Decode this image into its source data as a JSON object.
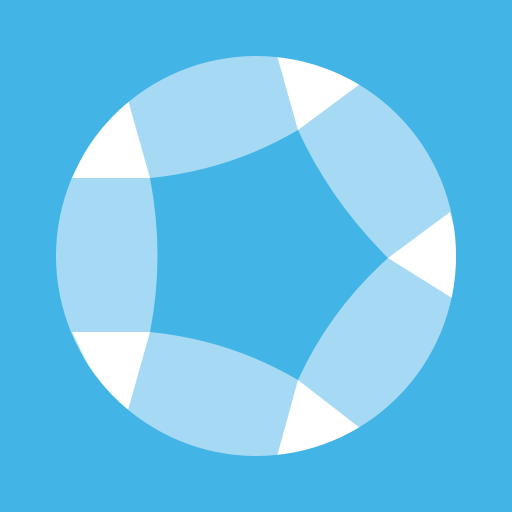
{
  "logo": {
    "icon": "circular-star-logo-icon",
    "colors": {
      "background": "#43B4E6",
      "band": "#A6DAF4",
      "highlight": "#FFFFFF"
    }
  }
}
